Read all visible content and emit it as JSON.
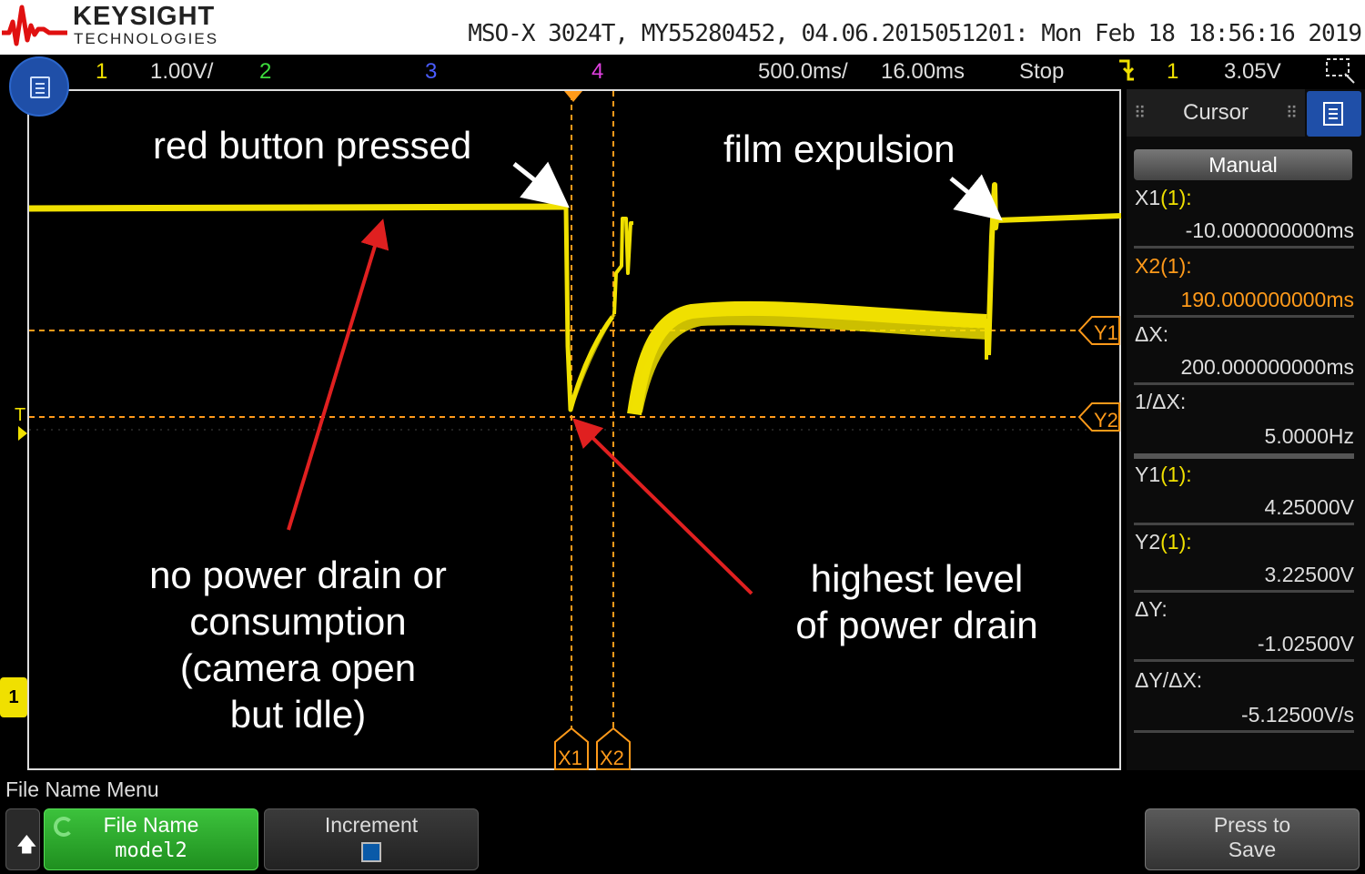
{
  "header": {
    "brand": "KEYSIGHT",
    "brand_sub": "TECHNOLOGIES",
    "device_info": "MSO-X 3024T, MY55280452, 04.06.2015051201: Mon Feb 18 18:56:16 2019"
  },
  "status_bar": {
    "ch1_num": "1",
    "ch1_scale": "1.00V/",
    "ch2_num": "2",
    "ch3_num": "3",
    "ch4_num": "4",
    "timebase": "500.0ms/",
    "delay": "16.00ms",
    "run_state": "Stop",
    "trigger_source": "1",
    "trigger_level": "3.05V"
  },
  "annotations": {
    "red_button": "red button pressed",
    "film": "film expulsion",
    "idle": [
      "no power drain or",
      "consumption",
      "(camera open",
      "but idle)"
    ],
    "highest": [
      "highest level",
      "of power drain"
    ]
  },
  "markers": {
    "x1": "X1",
    "x2": "X2",
    "y1": "Y1",
    "y2": "Y2",
    "trig": "T",
    "ch1_ground": "1"
  },
  "cursor_panel": {
    "title": "Cursor",
    "mode": "Manual",
    "x1_label": "X1",
    "x1_ch": "(1):",
    "x1_value": "-10.000000000ms",
    "x2_label": "X2",
    "x2_ch": "(1):",
    "x2_value": "190.000000000ms",
    "dx_label": "ΔX:",
    "dx_value": "200.000000000ms",
    "inv_dx_label": "1/ΔX:",
    "inv_dx_value": "5.0000Hz",
    "y1_label": "Y1",
    "y1_ch": "(1):",
    "y1_value": "4.25000V",
    "y2_label": "Y2",
    "y2_ch": "(1):",
    "y2_value": "3.22500V",
    "dy_label": "ΔY:",
    "dy_value": "-1.02500V",
    "dydx_label": "ΔY/ΔX:",
    "dydx_value": "-5.12500V/s"
  },
  "softkeys": {
    "menu_title": "File Name Menu",
    "filename_label": "File Name",
    "filename_value": "model2",
    "increment_label": "Increment",
    "save_line1": "Press to",
    "save_line2": "Save"
  },
  "colors": {
    "ch1": "#f0e000",
    "ch2": "#3ddc3d",
    "ch3": "#4a5cff",
    "ch4": "#e040e0",
    "cursor": "#ff9a1a",
    "arrow": "#e02020"
  },
  "icons": [
    "menu-icon",
    "keysight-logo-icon",
    "trigger-edge-icon",
    "zoom-icon",
    "up-arrow-icon",
    "refresh-icon",
    "grab-handle-icon"
  ]
}
